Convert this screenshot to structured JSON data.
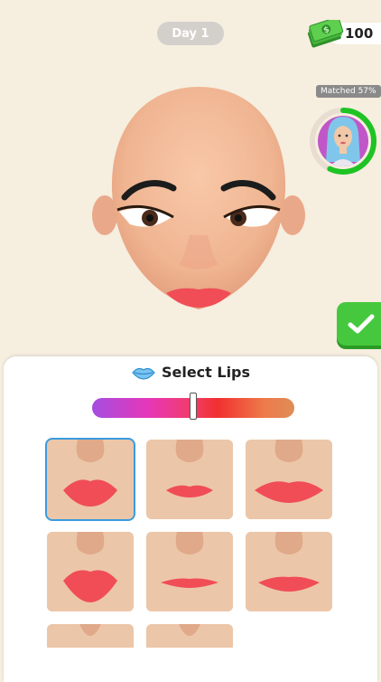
{
  "header": {
    "day_label": "Day 1",
    "money_amount": "100",
    "money_icon": "cash-stack-icon"
  },
  "matched": {
    "label": "Matched 57%",
    "progress": 0.57
  },
  "panel": {
    "title": "Select Lips",
    "title_icon": "lips-icon",
    "slider_value": 0.5
  },
  "colors": {
    "background": "#f6eedf",
    "accent_green": "#46c83e",
    "selected_outline": "#3a9be0",
    "lip_color": "#f04d57"
  },
  "lip_options": [
    {
      "style": "full",
      "selected": true
    },
    {
      "style": "thin",
      "selected": false
    },
    {
      "style": "wide",
      "selected": false
    },
    {
      "style": "pout",
      "selected": false
    },
    {
      "style": "narrow",
      "selected": false
    },
    {
      "style": "flat",
      "selected": false
    },
    {
      "style": "partial",
      "selected": false
    },
    {
      "style": "partial",
      "selected": false
    }
  ]
}
